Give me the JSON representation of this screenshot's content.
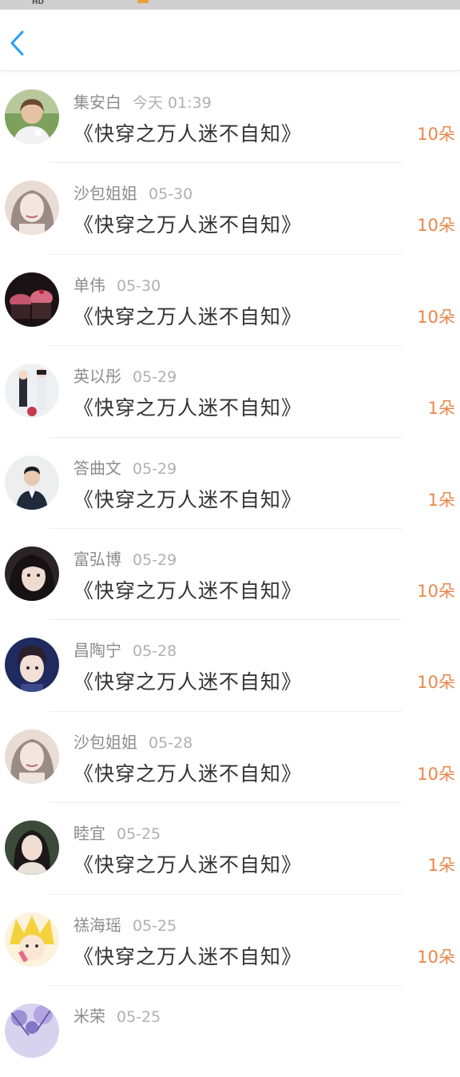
{
  "status_bar": {
    "hd_label": "HD"
  },
  "nav": {
    "back_icon": "chevron-left-icon",
    "accent_color": "#2a9df4"
  },
  "colors": {
    "gift": "#e8874a",
    "username": "#8c8c8c",
    "date": "#b0b0b0",
    "title": "#333333"
  },
  "records": [
    {
      "user": "集安白",
      "date": "今天 01:39",
      "book": "《快穿之万人迷不自知》",
      "gift": "10朵",
      "avatar": "avatar-boy-photo"
    },
    {
      "user": "沙包姐姐",
      "date": "05-30",
      "book": "《快穿之万人迷不自知》",
      "gift": "10朵",
      "avatar": "avatar-painted-girl"
    },
    {
      "user": "单伟",
      "date": "05-30",
      "book": "《快穿之万人迷不自知》",
      "gift": "10朵",
      "avatar": "avatar-cupcakes"
    },
    {
      "user": "英以彤",
      "date": "05-29",
      "book": "《快穿之万人迷不自知》",
      "gift": "1朵",
      "avatar": "avatar-anime-couple"
    },
    {
      "user": "答曲文",
      "date": "05-29",
      "book": "《快穿之万人迷不自知》",
      "gift": "1朵",
      "avatar": "avatar-man-suit"
    },
    {
      "user": "富弘博",
      "date": "05-29",
      "book": "《快穿之万人迷不自知》",
      "gift": "10朵",
      "avatar": "avatar-girl-dark-hair"
    },
    {
      "user": "昌陶宁",
      "date": "05-28",
      "book": "《快穿之万人迷不自知》",
      "gift": "10朵",
      "avatar": "avatar-young-man"
    },
    {
      "user": "沙包姐姐",
      "date": "05-28",
      "book": "《快穿之万人迷不自知》",
      "gift": "10朵",
      "avatar": "avatar-painted-girl"
    },
    {
      "user": "睦宜",
      "date": "05-25",
      "book": "《快穿之万人迷不自知》",
      "gift": "1朵",
      "avatar": "avatar-woman-portrait"
    },
    {
      "user": "禚海瑶",
      "date": "05-25",
      "book": "《快穿之万人迷不自知》",
      "gift": "10朵",
      "avatar": "avatar-anime-blonde"
    },
    {
      "user": "米荣",
      "date": "05-25",
      "book": "",
      "gift": "",
      "avatar": "avatar-purple-flowers"
    }
  ]
}
